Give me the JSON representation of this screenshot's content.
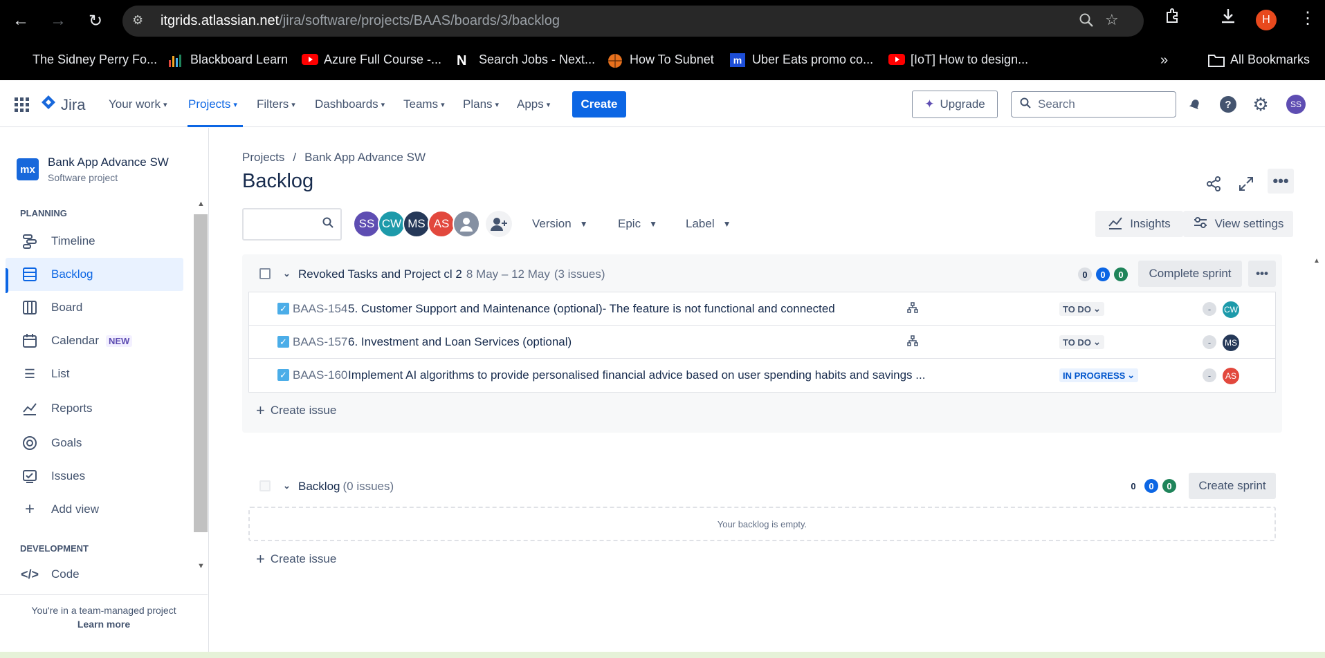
{
  "browser": {
    "url_host": "itgrids.atlassian.net",
    "url_path": "/jira/software/projects/BAAS/boards/3/backlog",
    "profile_initial": "H",
    "bookmarks": [
      {
        "label": "The Sidney Perry Fo...",
        "icon": "blank"
      },
      {
        "label": "Blackboard Learn",
        "icon": "bars-chart-icon"
      },
      {
        "label": "Azure Full Course -...",
        "icon": "youtube-icon"
      },
      {
        "label": "Search Jobs - Next...",
        "icon": "n-icon"
      },
      {
        "label": "How To Subnet",
        "icon": "basketball-icon"
      },
      {
        "label": "Uber Eats promo co...",
        "icon": "m-icon"
      },
      {
        "label": "[IoT] How to design...",
        "icon": "youtube-icon"
      }
    ],
    "all_bookmarks": "All Bookmarks"
  },
  "jira_nav": {
    "logo": "Jira",
    "items": [
      "Your work",
      "Projects",
      "Filters",
      "Dashboards",
      "Teams",
      "Plans",
      "Apps"
    ],
    "create": "Create",
    "upgrade": "Upgrade",
    "search_placeholder": "Search",
    "user_initials": "SS"
  },
  "sidebar": {
    "project_logo": "mx",
    "project_name": "Bank App Advance SW",
    "project_type": "Software project",
    "planning_label": "PLANNING",
    "items": [
      {
        "label": "Timeline",
        "icon": "timeline-icon"
      },
      {
        "label": "Backlog",
        "icon": "backlog-icon"
      },
      {
        "label": "Board",
        "icon": "board-icon"
      },
      {
        "label": "Calendar",
        "icon": "calendar-icon",
        "badge": "NEW"
      },
      {
        "label": "List",
        "icon": "list-icon"
      },
      {
        "label": "Reports",
        "icon": "reports-icon"
      },
      {
        "label": "Goals",
        "icon": "goals-icon"
      },
      {
        "label": "Issues",
        "icon": "issues-icon"
      },
      {
        "label": "Add view",
        "icon": "plus-icon"
      }
    ],
    "development_label": "DEVELOPMENT",
    "dev_items": [
      {
        "label": "Code",
        "icon": "code-icon"
      }
    ],
    "team_msg": "You're in a team-managed project",
    "learn_more": "Learn more"
  },
  "main": {
    "breadcrumb": [
      "Projects",
      "Bank App Advance SW"
    ],
    "title": "Backlog",
    "avatars": [
      {
        "initials": "SS",
        "color": "#5e4db2"
      },
      {
        "initials": "CW",
        "color": "#1d9aaa"
      },
      {
        "initials": "MS",
        "color": "#253858"
      },
      {
        "initials": "AS",
        "color": "#e2483d"
      }
    ],
    "filters": [
      "Version",
      "Epic",
      "Label"
    ],
    "insights": "Insights",
    "view_settings": "View settings"
  },
  "sprint": {
    "name": "Revoked Tasks and Project cl 2",
    "dates": "8 May – 12 May",
    "count": "(3 issues)",
    "badges": [
      "0",
      "0",
      "0"
    ],
    "action": "Complete sprint",
    "issues": [
      {
        "key": "BAAS-154",
        "summary": "5. Customer Support and Maintenance (optional)- The feature is not functional and connected",
        "status": "TO DO",
        "sp": "-",
        "assignee": "CW",
        "assignee_color": "#1d9aaa",
        "has_child": true
      },
      {
        "key": "BAAS-157",
        "summary": "6. Investment and Loan Services (optional)",
        "status": "TO DO",
        "sp": "-",
        "assignee": "MS",
        "assignee_color": "#253858",
        "has_child": true
      },
      {
        "key": "BAAS-160",
        "summary": "Implement AI algorithms to provide personalised financial advice based on user spending habits and savings ...",
        "status": "IN PROGRESS",
        "sp": "-",
        "assignee": "AS",
        "assignee_color": "#e2483d",
        "has_child": false
      }
    ],
    "create_issue": "Create issue"
  },
  "backlog": {
    "name": "Backlog",
    "count": "(0 issues)",
    "badges": [
      "0",
      "0",
      "0"
    ],
    "action": "Create sprint",
    "empty": "Your backlog is empty.",
    "create_issue": "Create issue"
  }
}
